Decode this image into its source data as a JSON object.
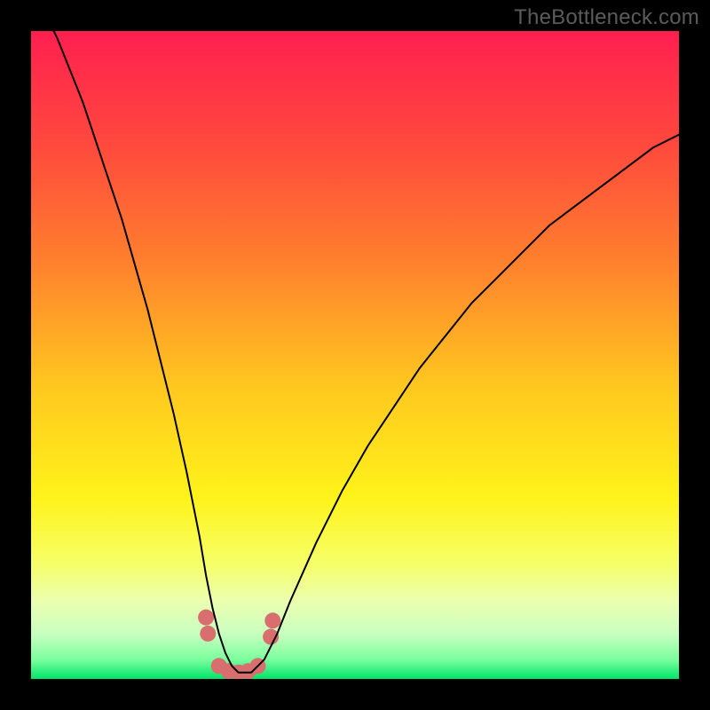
{
  "watermark": "TheBottleneck.com",
  "chart_data": {
    "type": "line",
    "title": "",
    "xlabel": "",
    "ylabel": "",
    "xlim": [
      0,
      100
    ],
    "ylim": [
      0,
      100
    ],
    "grid": false,
    "legend": false,
    "background_gradient_stops": [
      {
        "offset": 0.0,
        "color": "#ff1f4f"
      },
      {
        "offset": 0.18,
        "color": "#ff4a3d"
      },
      {
        "offset": 0.35,
        "color": "#ff7e2e"
      },
      {
        "offset": 0.55,
        "color": "#ffc81f"
      },
      {
        "offset": 0.72,
        "color": "#fff31a"
      },
      {
        "offset": 0.82,
        "color": "#f6ff66"
      },
      {
        "offset": 0.88,
        "color": "#ecffb0"
      },
      {
        "offset": 0.93,
        "color": "#c9ffc0"
      },
      {
        "offset": 0.97,
        "color": "#7bff9e"
      },
      {
        "offset": 1.0,
        "color": "#00e46a"
      }
    ],
    "series": [
      {
        "name": "bottleneck-curve",
        "color": "#000000",
        "stroke_width": 2,
        "x": [
          2,
          4,
          6,
          8,
          10,
          12,
          14,
          16,
          18,
          20,
          22,
          24,
          26,
          27,
          28,
          29,
          30,
          31,
          32,
          33,
          34,
          35,
          36,
          38,
          40,
          44,
          48,
          52,
          56,
          60,
          64,
          68,
          72,
          76,
          80,
          84,
          88,
          92,
          96,
          100
        ],
        "y": [
          103,
          99,
          94,
          89,
          83,
          77,
          71,
          64,
          57,
          49,
          41,
          32,
          22,
          16,
          11,
          7,
          4,
          2,
          1,
          1,
          1,
          2,
          3,
          7,
          12,
          21,
          29,
          36,
          42,
          48,
          53,
          58,
          62,
          66,
          70,
          73,
          76,
          79,
          82,
          84
        ]
      }
    ],
    "highlight_dots": {
      "color": "#d96e6e",
      "radius": 9,
      "points": [
        {
          "x": 27.0,
          "y": 9.5
        },
        {
          "x": 27.3,
          "y": 7.0
        },
        {
          "x": 29.0,
          "y": 2.0
        },
        {
          "x": 30.5,
          "y": 1.2
        },
        {
          "x": 32.0,
          "y": 1.0
        },
        {
          "x": 33.5,
          "y": 1.2
        },
        {
          "x": 35.0,
          "y": 2.0
        },
        {
          "x": 37.0,
          "y": 6.5
        },
        {
          "x": 37.3,
          "y": 9.0
        }
      ]
    }
  }
}
